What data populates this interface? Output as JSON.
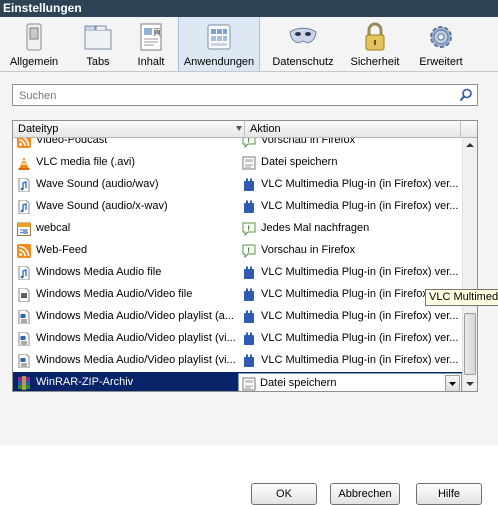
{
  "window": {
    "title": "Einstellungen"
  },
  "toolbar": {
    "items": [
      {
        "label": "Allgemein"
      },
      {
        "label": "Tabs"
      },
      {
        "label": "Inhalt"
      },
      {
        "label": "Anwendungen",
        "active": true
      },
      {
        "label": "Datenschutz"
      },
      {
        "label": "Sicherheit"
      },
      {
        "label": "Erweitert"
      }
    ]
  },
  "search": {
    "placeholder": "Suchen",
    "value": ""
  },
  "table": {
    "headers": {
      "type": "Dateityp",
      "action": "Aktion"
    },
    "rows": [
      {
        "type": "Video-Podcast",
        "type_icon": "feed-icon",
        "action": "Vorschau in Firefox",
        "action_icon": "preview-icon"
      },
      {
        "type": "VLC media file (.avi)",
        "type_icon": "vlc-cone-icon",
        "action": "Datei speichern",
        "action_icon": "save-file-icon"
      },
      {
        "type": "Wave Sound (audio/wav)",
        "type_icon": "audio-file-icon",
        "action": "VLC Multimedia Plug-in (in Firefox) ver...",
        "action_icon": "plugin-icon"
      },
      {
        "type": "Wave Sound (audio/x-wav)",
        "type_icon": "audio-file-icon",
        "action": "VLC Multimedia Plug-in (in Firefox) ver...",
        "action_icon": "plugin-icon"
      },
      {
        "type": "webcal",
        "type_icon": "calendar-icon",
        "action": "Jedes Mal nachfragen",
        "action_icon": "ask-icon"
      },
      {
        "type": "Web-Feed",
        "type_icon": "feed-icon",
        "action": "Vorschau in Firefox",
        "action_icon": "preview-icon"
      },
      {
        "type": "Windows Media Audio file",
        "type_icon": "audio-file-icon",
        "action": "VLC Multimedia Plug-in (in Firefox) ver...",
        "action_icon": "plugin-icon"
      },
      {
        "type": "Windows Media Audio/Video file",
        "type_icon": "video-file-icon",
        "action": "VLC Multimedia Plug-in (in Firefox) ver...",
        "action_icon": "plugin-icon"
      },
      {
        "type": "Windows Media Audio/Video playlist (a...",
        "type_icon": "playlist-icon",
        "action": "VLC Multimedia Plug-in (in Firefox) ver...",
        "action_icon": "plugin-icon"
      },
      {
        "type": "Windows Media Audio/Video playlist (vi...",
        "type_icon": "playlist-icon",
        "action": "VLC Multimedia Plug-in (in Firefox) ver...",
        "action_icon": "plugin-icon"
      },
      {
        "type": "Windows Media Audio/Video playlist (vi...",
        "type_icon": "playlist-icon",
        "action": "VLC Multimedia Plug-in (in Firefox) ver...",
        "action_icon": "plugin-icon"
      },
      {
        "type": "WinRAR-ZIP-Archiv",
        "type_icon": "winrar-icon",
        "action": "Datei speichern",
        "action_icon": "save-file-icon",
        "selected": true
      }
    ]
  },
  "tooltip": {
    "text": "VLC Multimedia"
  },
  "buttons": {
    "ok": "OK",
    "cancel": "Abbrechen",
    "help": "Hilfe"
  },
  "colors": {
    "selection": "#0a246a",
    "titlebar": "#2f4356",
    "active_tab": "#dde8f4"
  }
}
